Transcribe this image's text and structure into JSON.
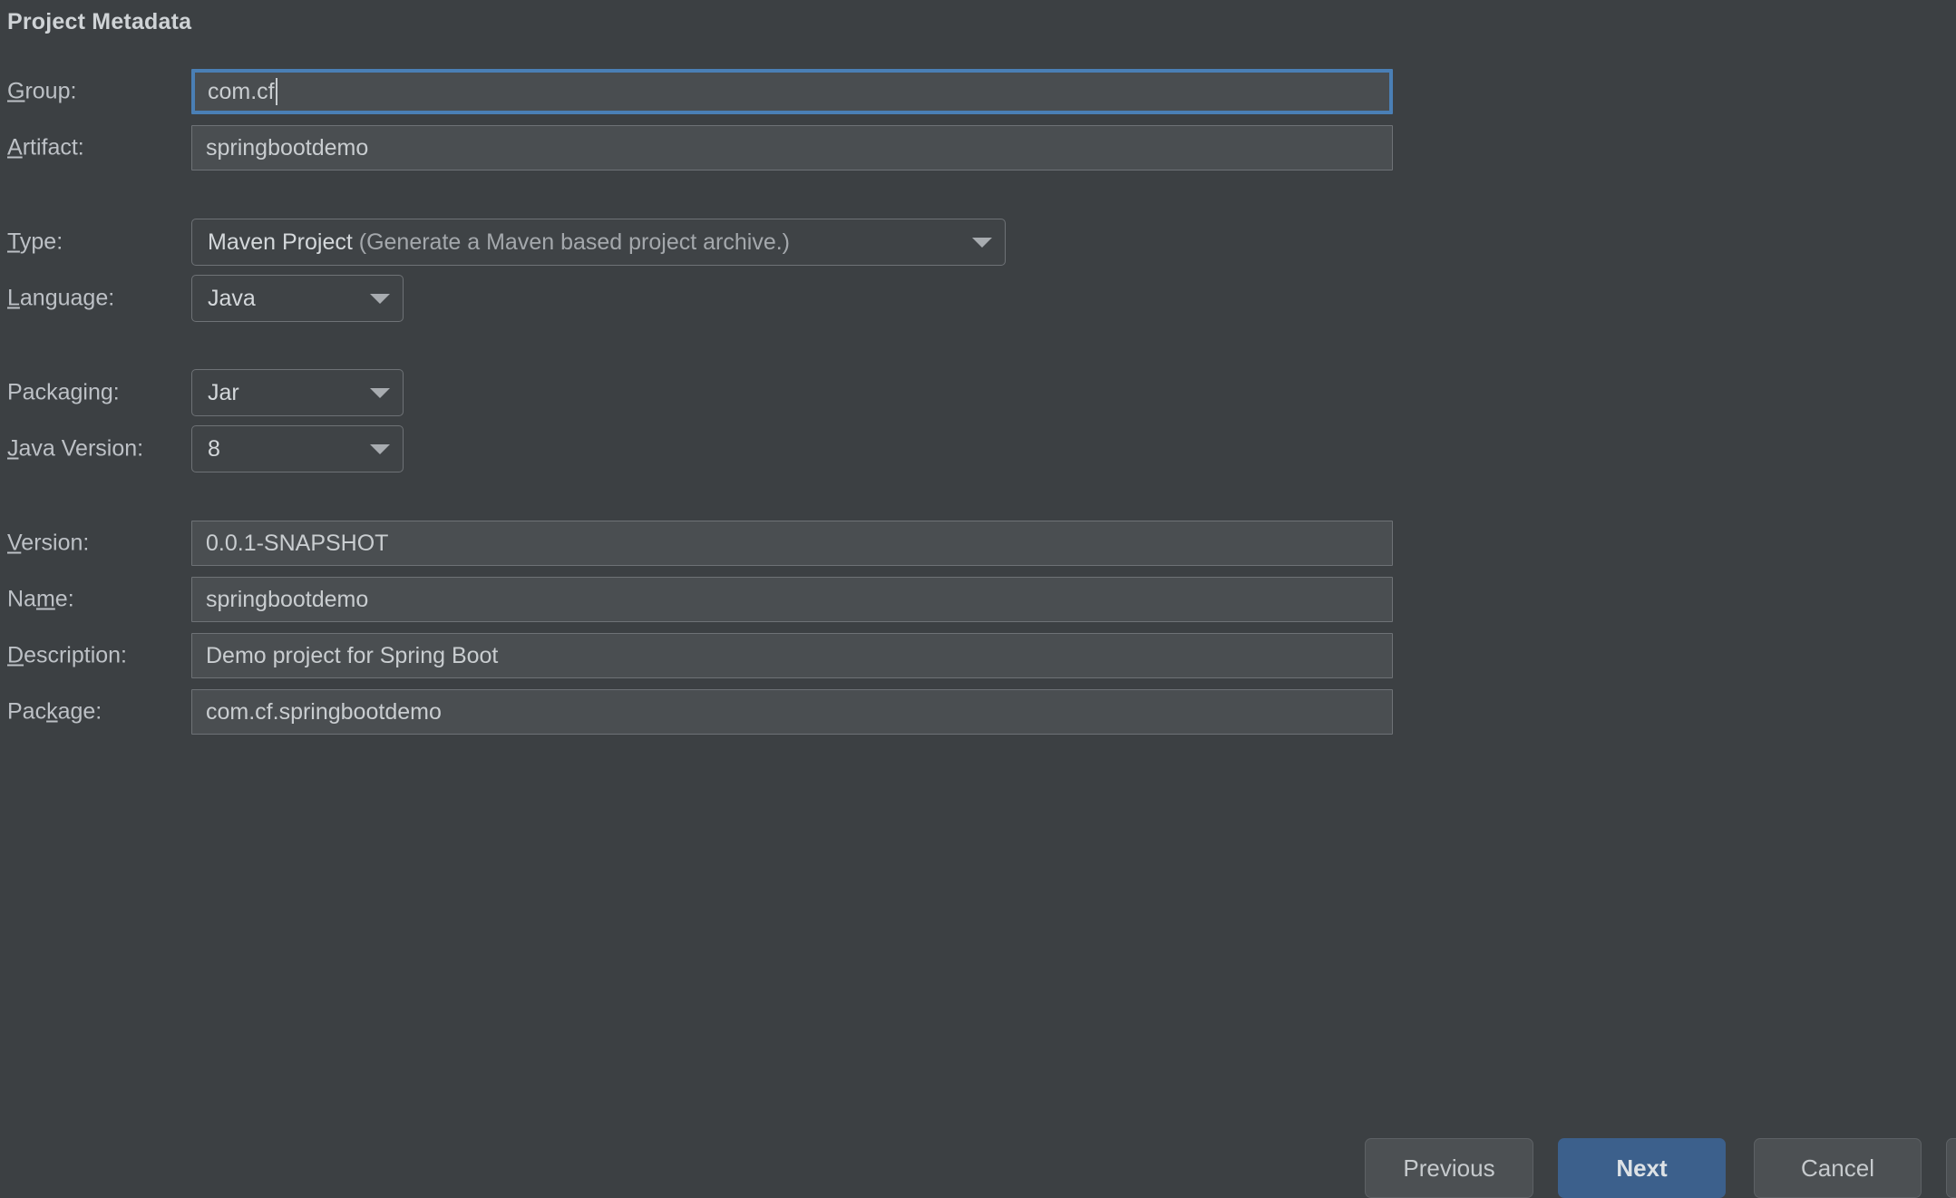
{
  "dialog": {
    "section_title": "Project Metadata"
  },
  "form": {
    "fields": [
      {
        "id": "group",
        "label_prefix": "",
        "label_mnemonic": "G",
        "label_suffix": "roup:",
        "control": "text",
        "value": "com.cf",
        "focused": true
      },
      {
        "id": "artifact",
        "label_prefix": "",
        "label_mnemonic": "A",
        "label_suffix": "rtifact:",
        "control": "text",
        "value": "springbootdemo",
        "focused": false
      },
      {
        "id": "type",
        "label_prefix": "",
        "label_mnemonic": "T",
        "label_suffix": "ype:",
        "control": "combo-wide",
        "value_primary": "Maven Project",
        "value_secondary": "(Generate a Maven based project archive.)"
      },
      {
        "id": "language",
        "label_prefix": "",
        "label_mnemonic": "L",
        "label_suffix": "anguage:",
        "control": "combo-narrow",
        "value_primary": "Java",
        "value_secondary": ""
      },
      {
        "id": "packaging",
        "label_prefix": "Packa",
        "label_mnemonic": "g",
        "label_suffix": "ing:",
        "control": "combo-narrow",
        "value_primary": "Jar",
        "value_secondary": ""
      },
      {
        "id": "java-version",
        "label_prefix": "",
        "label_mnemonic": "J",
        "label_suffix": "ava Version:",
        "control": "combo-narrow",
        "value_primary": "8",
        "value_secondary": ""
      },
      {
        "id": "version",
        "label_prefix": "",
        "label_mnemonic": "V",
        "label_suffix": "ersion:",
        "control": "text",
        "value": "0.0.1-SNAPSHOT",
        "focused": false
      },
      {
        "id": "name",
        "label_prefix": "Na",
        "label_mnemonic": "m",
        "label_suffix": "e:",
        "control": "text",
        "value": "springbootdemo",
        "focused": false
      },
      {
        "id": "description",
        "label_prefix": "",
        "label_mnemonic": "D",
        "label_suffix": "escription:",
        "control": "text",
        "value": "Demo project for Spring Boot",
        "focused": false
      },
      {
        "id": "package",
        "label_prefix": "Pac",
        "label_mnemonic": "k",
        "label_suffix": "age:",
        "control": "text",
        "value": "com.cf.springbootdemo",
        "focused": false
      }
    ]
  },
  "buttons": {
    "previous": "Previous",
    "next": "Next",
    "cancel": "Cancel",
    "help": ""
  },
  "colors": {
    "panel_background": "#3c4043",
    "input_background": "#4a4e51",
    "input_border": "#6e7276",
    "focus_border": "#4a7fb5",
    "primary_button": "#3c608c",
    "text": "#bdc1c6",
    "secondary_text": "#a4a8ac"
  }
}
